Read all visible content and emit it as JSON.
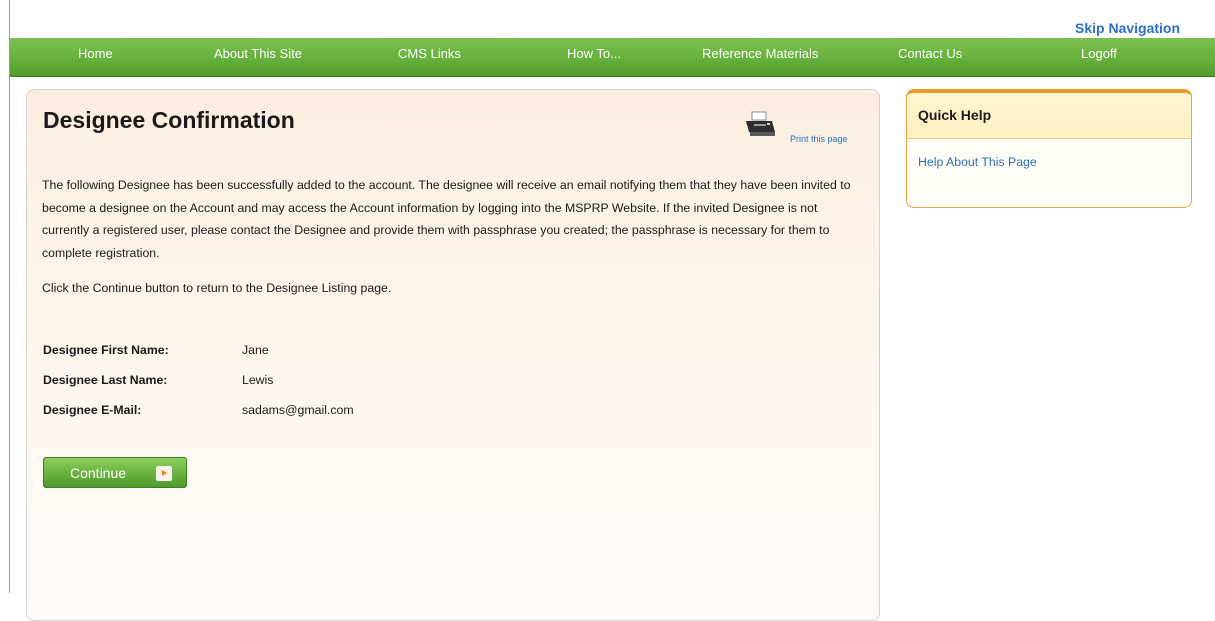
{
  "skip_navigation": "Skip Navigation",
  "nav": {
    "items": [
      {
        "label": "Home"
      },
      {
        "label": "About This Site"
      },
      {
        "label": "CMS Links"
      },
      {
        "label": "How To..."
      },
      {
        "label": "Reference Materials"
      },
      {
        "label": "Contact Us"
      },
      {
        "label": "Logoff"
      }
    ]
  },
  "main": {
    "title": "Designee Confirmation",
    "print_link": "Print this page",
    "intro": "The following Designee has been successfully added to the account. The designee will receive an email notifying them that they have been invited to become a designee on the Account and may access the Account information by logging into the MSPRP Website. If the invited Designee is not currently a registered user, please contact the Designee and provide them with passphrase you created; the passphrase is necessary for them to complete registration.",
    "instruction": "Click the Continue button to return to the Designee Listing page.",
    "fields": [
      {
        "label": "Designee First Name:",
        "value": "Jane"
      },
      {
        "label": "Designee Last Name:",
        "value": "Lewis"
      },
      {
        "label": "Designee E-Mail:",
        "value": "sadams@gmail.com"
      }
    ],
    "continue_label": "Continue"
  },
  "quick_help": {
    "title": "Quick Help",
    "link": "Help About This Page"
  },
  "colors": {
    "nav_green": "#66b03c",
    "link_blue": "#2a6fc4",
    "help_border_orange": "#e89a2a",
    "panel_background": "#fdf5ec"
  },
  "icons": {
    "print": "printer-icon",
    "continue": "arrow-right-icon"
  }
}
